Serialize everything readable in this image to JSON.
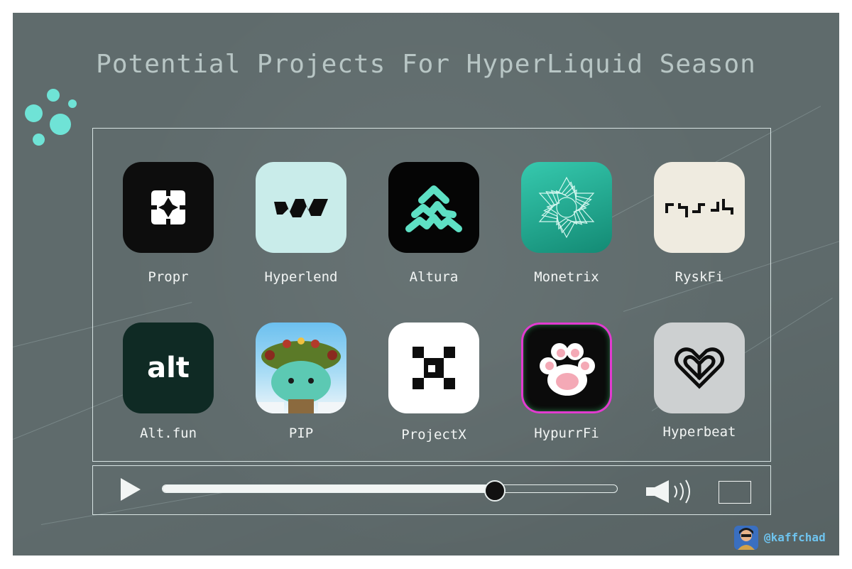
{
  "page": {
    "title": "Potential Projects For HyperLiquid Season"
  },
  "colors": {
    "background": "#5f6b6c",
    "accent_dots": "#6fe3d6",
    "frame": "#d8e4e3",
    "label_text": "#f2f5f4",
    "handle_text": "#6ec3ee"
  },
  "projects": [
    {
      "name": "Propr",
      "icon": "propr-logo-icon"
    },
    {
      "name": "Hyperlend",
      "icon": "hyperlend-logo-icon"
    },
    {
      "name": "Altura",
      "icon": "altura-logo-icon"
    },
    {
      "name": "Monetrix",
      "icon": "monetrix-logo-icon"
    },
    {
      "name": "RyskFi",
      "icon": "ryskfi-logo-icon"
    },
    {
      "name": "Alt.fun",
      "icon": "altfun-logo-icon",
      "logo_text": "alt"
    },
    {
      "name": "PIP",
      "icon": "pip-logo-icon"
    },
    {
      "name": "ProjectX",
      "icon": "projectx-logo-icon"
    },
    {
      "name": "HypurrFi",
      "icon": "hypurrfi-logo-icon"
    },
    {
      "name": "Hyperbeat",
      "icon": "hyperbeat-logo-icon"
    }
  ],
  "player": {
    "progress": 0.73,
    "icons": [
      "play-icon",
      "volume-icon",
      "fullscreen-icon"
    ]
  },
  "credit": {
    "handle": "@kaffchad",
    "icon": "avatar-icon"
  }
}
